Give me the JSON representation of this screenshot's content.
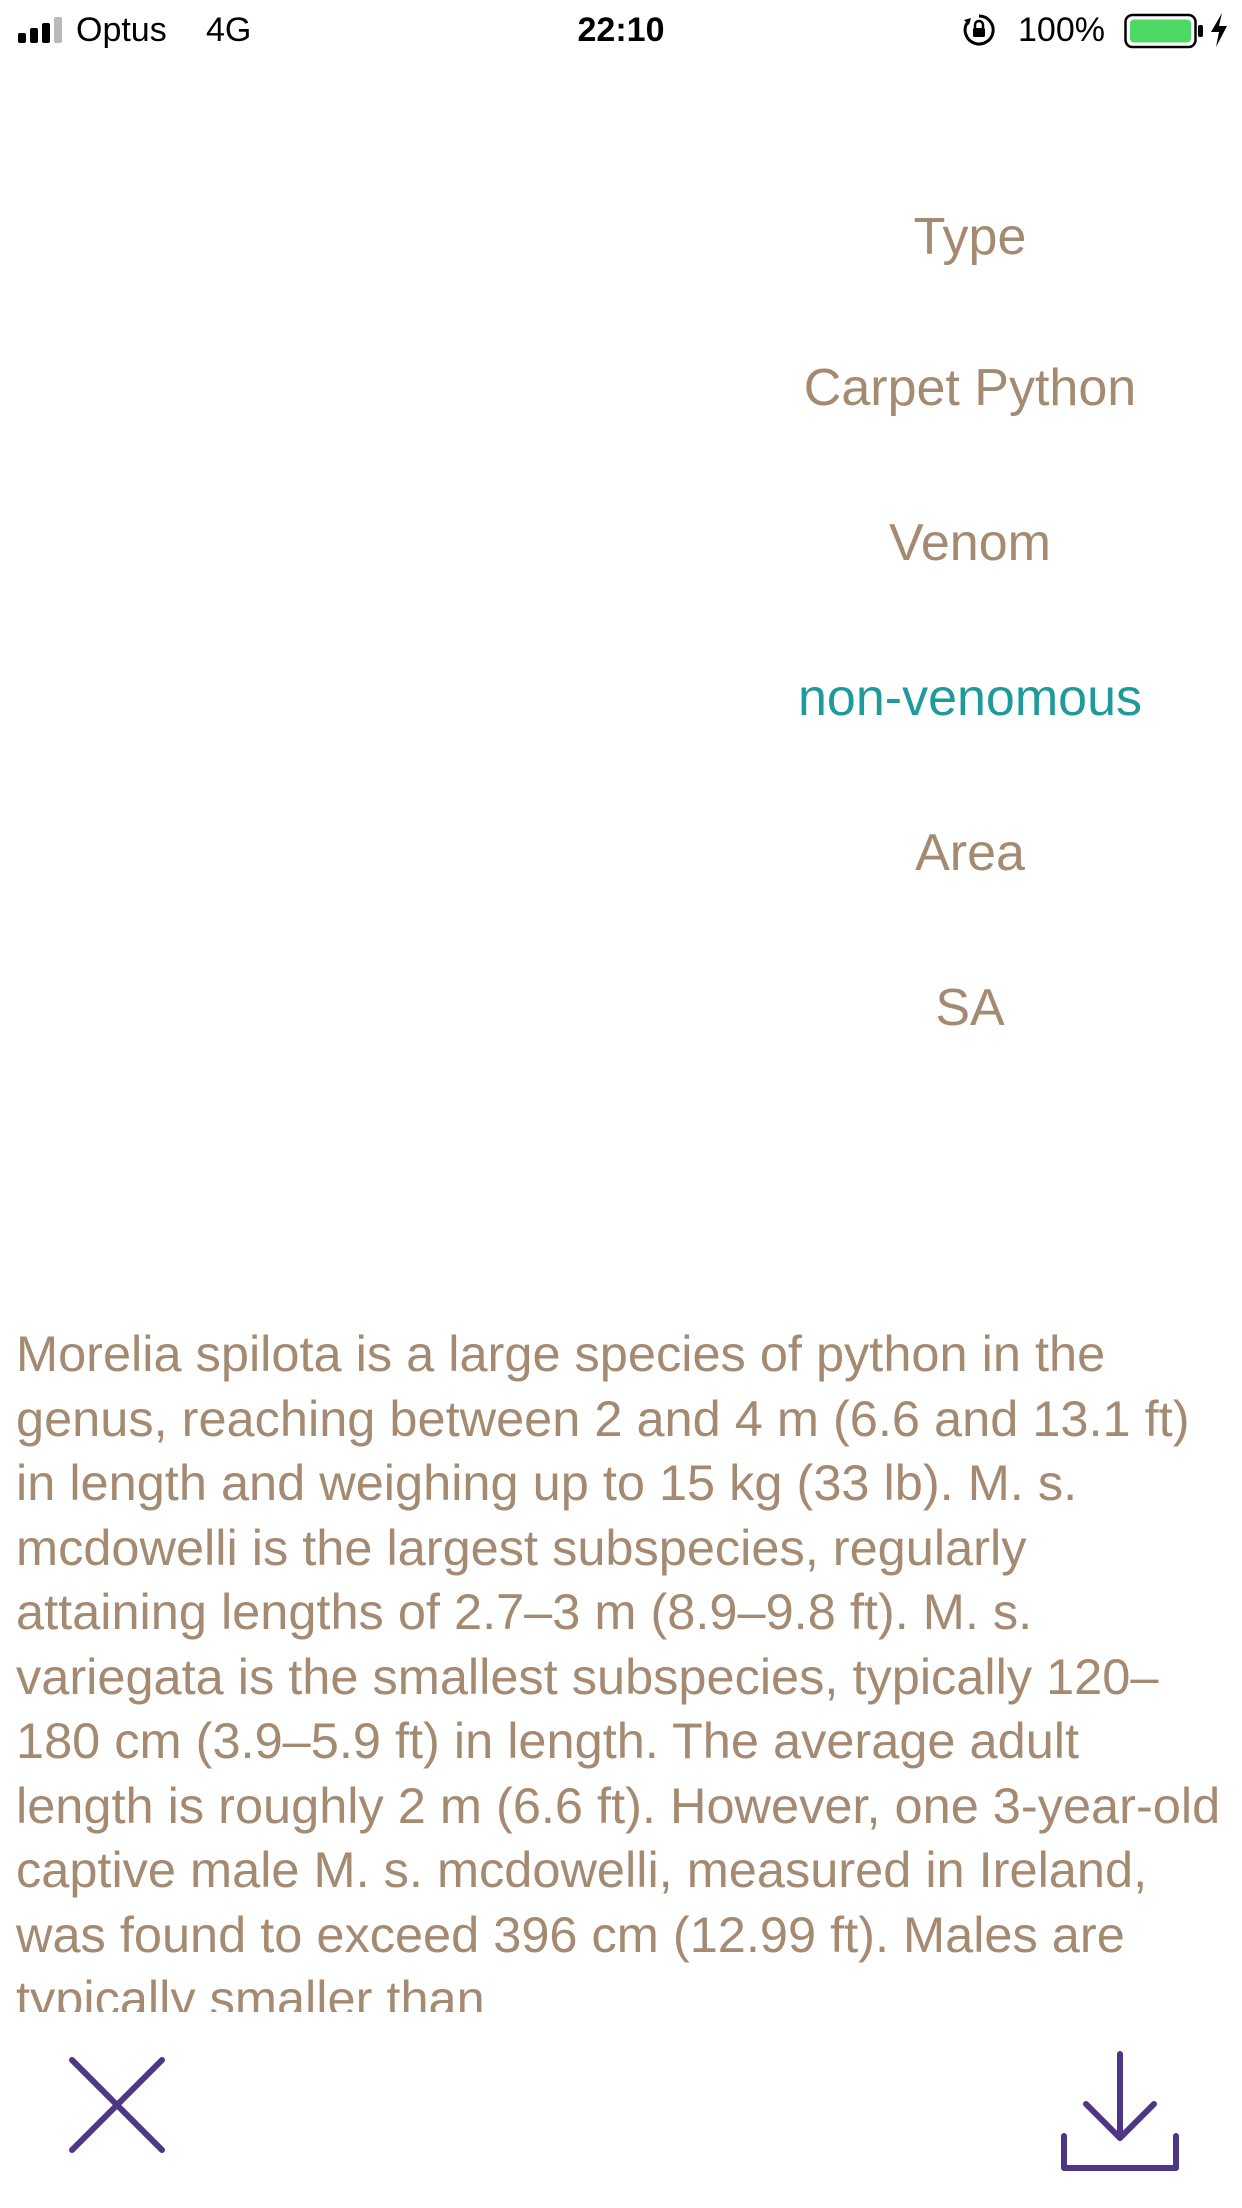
{
  "status_bar": {
    "carrier": "Optus",
    "network": "4G",
    "time": "22:10",
    "battery_percent": "100%",
    "signal_bars": 3,
    "icons": [
      "signal-icon",
      "rotation-lock-icon",
      "battery-icon",
      "charging-icon"
    ],
    "battery_color": "#4cd964"
  },
  "info": {
    "type_label": "Type",
    "type_value": "Carpet Python",
    "venom_label": "Venom",
    "venom_value": "non-venomous",
    "area_label": "Area",
    "area_value": "SA"
  },
  "description": "Morelia spilota is a large species of python in the genus, reaching between 2 and 4 m (6.6 and 13.1 ft) in length and weighing up to 15 kg (33 lb). M. s. mcdowelli is the largest subspecies, regularly attaining lengths of 2.7–3 m (8.9–9.8 ft). M. s. variegata is the smallest subspecies, typically 120–180 cm (3.9–5.9 ft) in length. The average adult length is roughly 2 m (6.6 ft). However, one 3-year-old captive male M. s. mcdowelli, measured in Ireland, was found to exceed 396 cm (12.99 ft). Males are typically smaller than",
  "actions": {
    "close_icon": "close-icon",
    "download_icon": "download-icon"
  },
  "colors": {
    "text": "#a58a72",
    "accent": "#1e9a9a",
    "button": "#4e3585"
  }
}
